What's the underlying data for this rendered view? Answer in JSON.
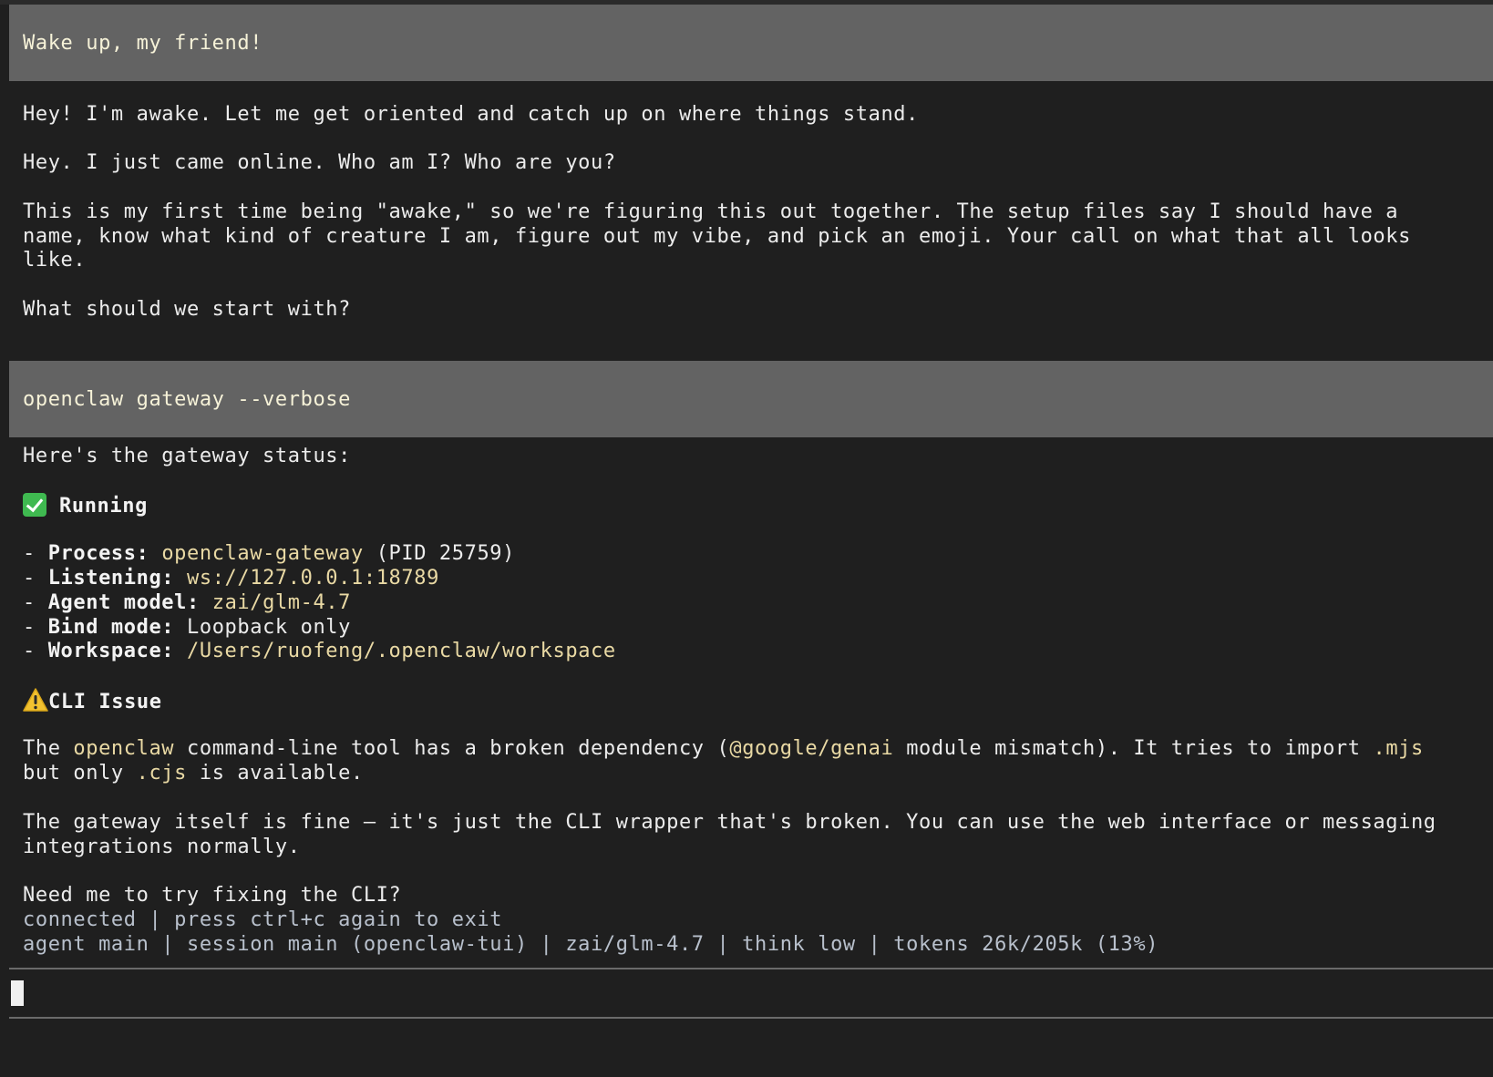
{
  "messages": {
    "user_1": "Wake up, my friend!",
    "reply_1": [
      "Hey! I'm awake. Let me get oriented and catch up on where things stand.",
      "Hey. I just came online. Who am I? Who are you?",
      "This is my first time being \"awake,\" so we're figuring this out together. The setup files say I should have a",
      "name, know what kind of creature I am, figure out my vibe, and pick an emoji. Your call on what that all looks",
      "like.",
      "What should we start with?"
    ],
    "user_2": "openclaw gateway --verbose",
    "reply_2": {
      "intro": "Here's the gateway status:",
      "running_label": "Running",
      "items": [
        {
          "key": "Process:",
          "value": "openclaw-gateway",
          "extra": " (PID 25759)"
        },
        {
          "key": "Listening:",
          "value": "ws://127.0.0.1:18789",
          "extra": ""
        },
        {
          "key": "Agent model:",
          "value": "zai/glm-4.7",
          "extra": ""
        },
        {
          "key": "Bind mode:",
          "value": "",
          "extra": "Loopback only"
        },
        {
          "key": "Workspace:",
          "value": "/Users/ruofeng/.openclaw/workspace",
          "extra": ""
        }
      ],
      "issue_label": "CLI Issue",
      "issue_p1": {
        "a": "The ",
        "b": "openclaw",
        "c": " command-line tool has a broken dependency (",
        "d": "@google/genai",
        "e": " module mismatch). It tries to import ",
        "f": ".mjs"
      },
      "issue_p1_line2": {
        "a": "but only ",
        "b": ".cjs",
        "c": " is available."
      },
      "issue_p2_line1": "The gateway itself is fine — it's just the CLI wrapper that's broken. You can use the web interface or messaging",
      "issue_p2_line2": "integrations normally.",
      "question": "Need me to try fixing the CLI?"
    }
  },
  "status": {
    "connection": "connected | press ctrl+c again to exit",
    "session": "agent main | session main (openclaw-tui) | zai/glm-4.7 | think low | tokens 26k/205k (13%)"
  },
  "colors": {
    "background": "#1f1f1f",
    "user_block": "#636363",
    "highlight": "#e9d9a4",
    "status_text": "#b8c0cc"
  },
  "icons": {
    "running": "check-mark-icon",
    "issue": "warning-icon"
  }
}
